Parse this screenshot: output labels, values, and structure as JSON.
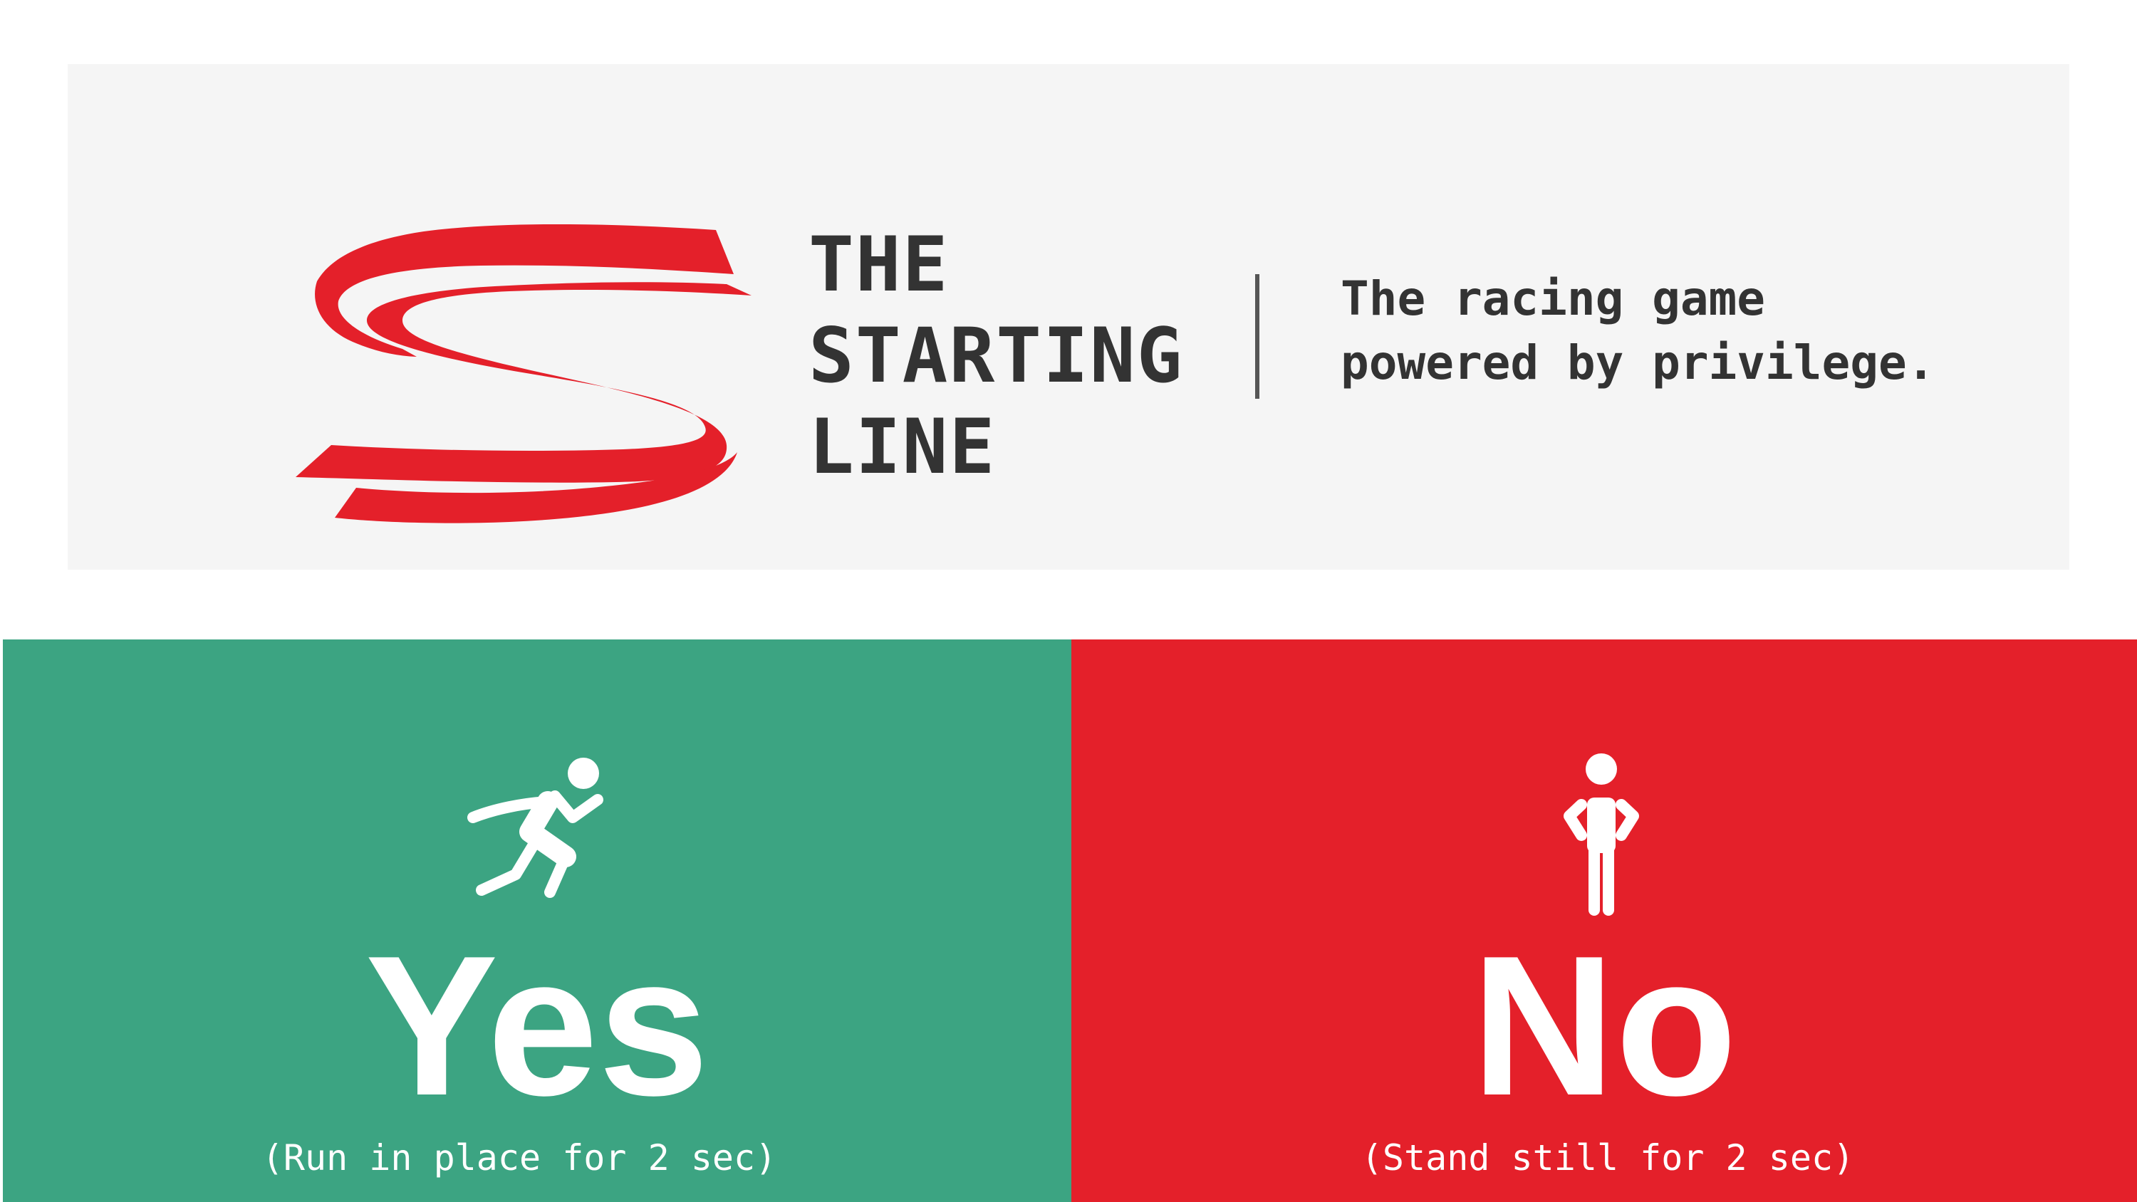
{
  "header": {
    "logo_icon": "red-s-track-logo-icon",
    "title_lines": [
      "THE",
      "STARTING",
      "LINE"
    ],
    "tagline_lines": [
      "The racing game",
      "powered by privilege."
    ]
  },
  "options": {
    "yes": {
      "icon": "running-person-icon",
      "label": "Yes",
      "instruction": "(Run in place for 2 sec)"
    },
    "no": {
      "icon": "standing-person-icon",
      "label": "No",
      "instruction": "(Stand still for 2 sec)"
    }
  },
  "colors": {
    "brand_red": "#e4202a",
    "yes_green": "#3ca482",
    "banner_bg": "#f5f5f5",
    "title_text": "#333333"
  }
}
